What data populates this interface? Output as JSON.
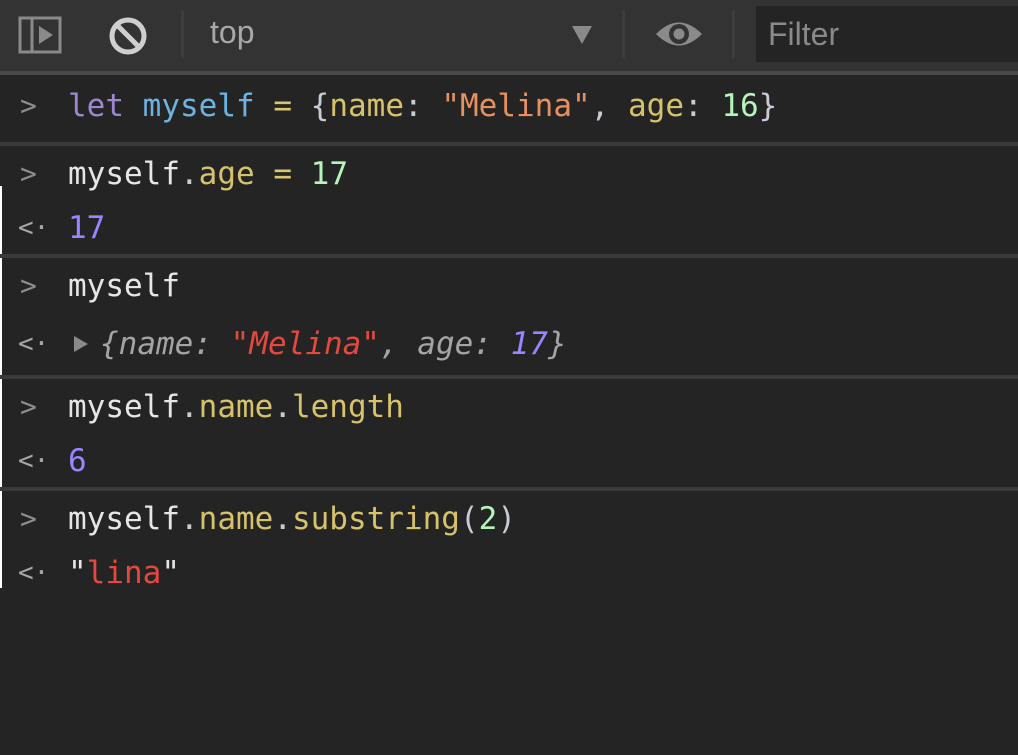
{
  "toolbar": {
    "sidebar_icon": "sidebar-toggle-icon",
    "clear_icon": "clear-console-icon",
    "context": "top",
    "context_dropdown_icon": "caret-down-icon",
    "live_expression_icon": "eye-icon",
    "filter_placeholder": "Filter",
    "filter_value": ""
  },
  "console": {
    "entries": [
      {
        "type": "input",
        "tokens": [
          "let",
          " ",
          "myself",
          " ",
          "=",
          " ",
          "{",
          "name",
          ":",
          " ",
          "\"Melina\"",
          ",",
          " ",
          "age",
          ":",
          " ",
          "16",
          "}"
        ]
      },
      {
        "type": "input",
        "tokens": [
          "myself",
          ".",
          "age",
          " ",
          "=",
          " ",
          "17"
        ],
        "result": "17"
      },
      {
        "type": "input",
        "tokens": [
          "myself"
        ],
        "result_object": {
          "open": "{",
          "key1": "name",
          "sep": ": ",
          "val1": "\"Melina\"",
          "comma": ", ",
          "key2": "age",
          "val2": "17",
          "close": "}"
        }
      },
      {
        "type": "input",
        "tokens": [
          "myself",
          ".",
          "name",
          ".",
          "length"
        ],
        "result": "6"
      },
      {
        "type": "input",
        "tokens": [
          "myself",
          ".",
          "name",
          ".",
          "substring",
          "(",
          "2",
          ")"
        ],
        "result": "\"lina\""
      }
    ],
    "prompt_symbol": ">",
    "result_symbol": "<·"
  }
}
